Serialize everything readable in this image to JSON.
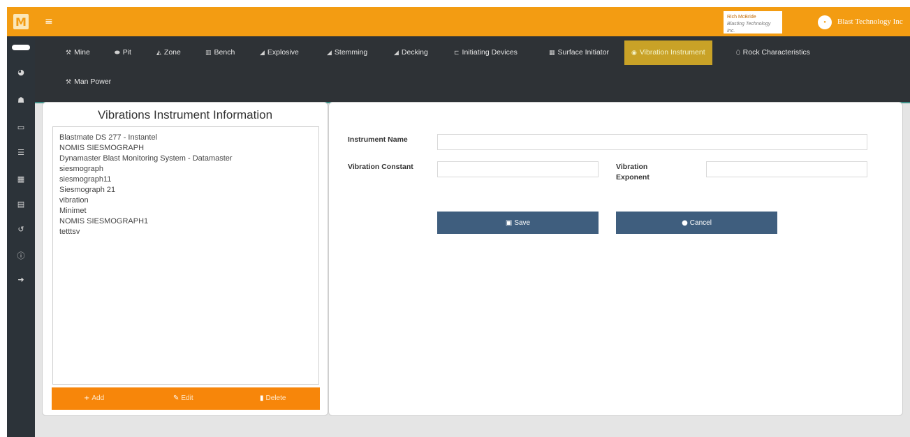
{
  "topbar": {
    "logo_letter": "M",
    "menu_icon": "≡",
    "user_name": "Rich McBride",
    "user_company": "Blasting Technology Inc.",
    "company_name": "Blast Technology Inc"
  },
  "sidebar_icons": [
    "toggle-pill-icon",
    "dashboard-icon",
    "users-icon",
    "folder-icon",
    "database-icon",
    "grid-icon",
    "id-card-icon",
    "history-icon",
    "info-icon",
    "logout-icon"
  ],
  "nav": {
    "items": [
      {
        "label": "Mine",
        "icon": "mine-icon"
      },
      {
        "label": "Pit",
        "icon": "pit-icon"
      },
      {
        "label": "Zone",
        "icon": "zone-icon"
      },
      {
        "label": "Bench",
        "icon": "bench-icon"
      },
      {
        "label": "Explosive",
        "icon": "explosive-icon"
      },
      {
        "label": "Stemming",
        "icon": "stemming-icon"
      },
      {
        "label": "Decking",
        "icon": "decking-icon"
      },
      {
        "label": "Initiating Devices",
        "icon": "initiating-devices-icon"
      },
      {
        "label": "Surface Initiator",
        "icon": "surface-initiator-icon"
      },
      {
        "label": "Vibration Instrument",
        "icon": "vibration-icon",
        "active": true
      },
      {
        "label": "Rock Characteristics",
        "icon": "rock-icon"
      },
      {
        "label": "Man Power",
        "icon": "man-power-icon"
      }
    ]
  },
  "left_panel": {
    "title": "Vibrations Instrument Information",
    "instruments": [
      "Blastmate DS 277 - Instantel",
      "NOMIS SIESMOGRAPH",
      "Dynamaster Blast Monitoring System - Datamaster",
      "siesmograph",
      "siesmograph11",
      "Siesmograph 21",
      "vibration",
      "Minimet",
      "NOMIS SIESMOGRAPH1",
      "tetttsv"
    ],
    "actions": {
      "add": "Add",
      "edit": "Edit",
      "delete": "Delete"
    }
  },
  "form": {
    "instrument_name_label": "Instrument Name",
    "instrument_name_value": "",
    "vibration_constant_label": "Vibration Constant",
    "vibration_constant_value": "",
    "vibration_exponent_label_1": "Vibration",
    "vibration_exponent_label_2": "Exponent",
    "vibration_exponent_value": "",
    "save_label": "Save",
    "cancel_label": "Cancel"
  },
  "colors": {
    "accent": "#f39c12",
    "nav_bg": "#2e3236",
    "active_tab": "#c9a227",
    "action_bar": "#f7860a",
    "button": "#3f5e7e"
  }
}
